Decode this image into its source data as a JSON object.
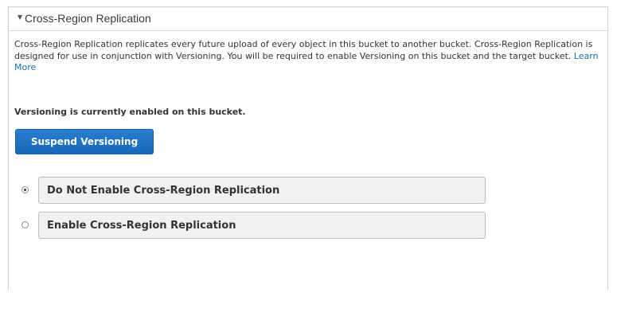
{
  "section": {
    "title": "Cross-Region Replication",
    "toggle_icon": "▼",
    "description": "Cross-Region Replication replicates every future upload of every object in this bucket to another bucket. Cross-Region Replication is designed for use in conjunction with Versioning. You will be required to enable Versioning on this bucket and the target bucket.",
    "learn_more_label": "Learn More"
  },
  "versioning": {
    "status": "Versioning is currently enabled on this bucket.",
    "suspend_label": "Suspend Versioning"
  },
  "replication_options": [
    {
      "label": "Do Not Enable Cross-Region Replication",
      "selected": true
    },
    {
      "label": "Enable Cross-Region Replication",
      "selected": false
    }
  ],
  "colors": {
    "button_blue": "#1a6fc4",
    "link_blue": "#1a6fb5",
    "option_bg": "#f1f1f1"
  }
}
